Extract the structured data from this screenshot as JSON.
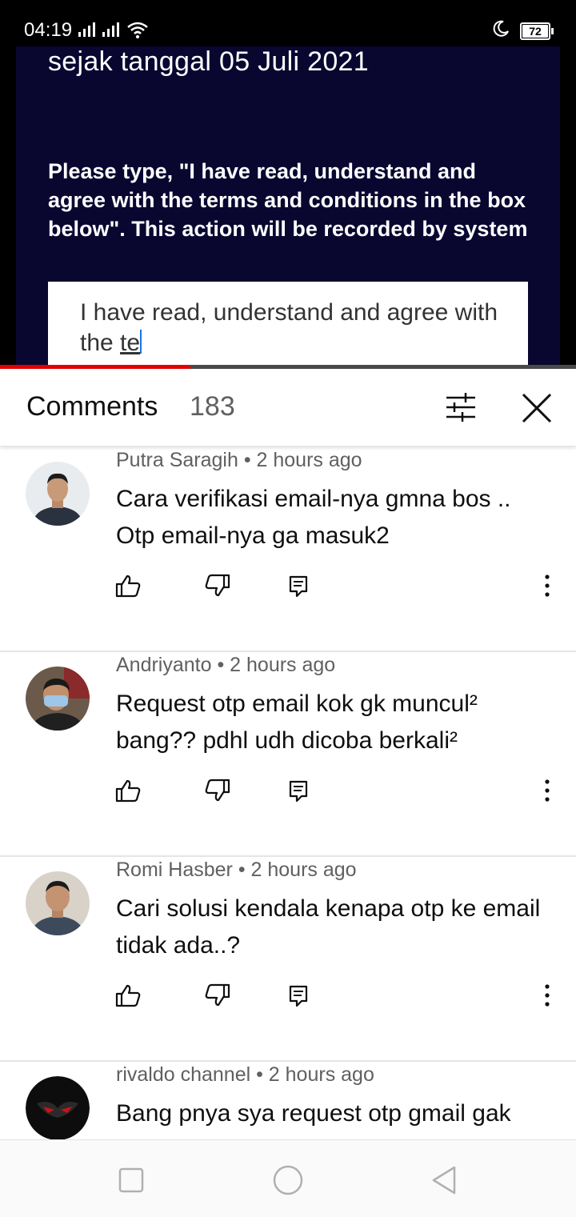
{
  "status_bar": {
    "time": "04:19",
    "battery": "72"
  },
  "video": {
    "date_line": "sejak tanggal 05 Juli 2021",
    "instruction": "Please type, \"I have read, understand and agree with the terms and conditions in the box below\". This action will be recorded by system",
    "typed_text_main": "I have read, understand and agree with the ",
    "typed_text_tail": "te"
  },
  "comments_header": {
    "title": "Comments",
    "count": "183"
  },
  "comments": [
    {
      "author": "Putra Saragih",
      "meta": "Putra Saragih • 2 hours ago",
      "text": "Cara verifikasi email-nya gmna bos .. Otp email-nya ga masuk2"
    },
    {
      "author": "Andriyanto",
      "meta": "Andriyanto • 2 hours ago",
      "text": "Request otp email kok gk muncul² bang?? pdhl udh dicoba berkali²"
    },
    {
      "author": "Romi Hasber",
      "meta": "Romi Hasber • 2 hours ago",
      "text": "Cari solusi kendala kenapa otp ke email tidak ada..?"
    },
    {
      "author": "rivaldo channel",
      "meta": "rivaldo channel • 2 hours ago",
      "text": "Bang pnya sya request otp gmail gak"
    }
  ],
  "colors": {
    "video_panel": "#090630",
    "progress_played": "#e00000",
    "meta_text": "#606060"
  },
  "icons": [
    "wifi-icon",
    "signal-icon",
    "moon-icon",
    "battery-icon",
    "filter-icon",
    "close-icon",
    "like-icon",
    "dislike-icon",
    "reply-icon",
    "more-vert-icon",
    "recents-icon",
    "home-icon",
    "back-icon"
  ]
}
